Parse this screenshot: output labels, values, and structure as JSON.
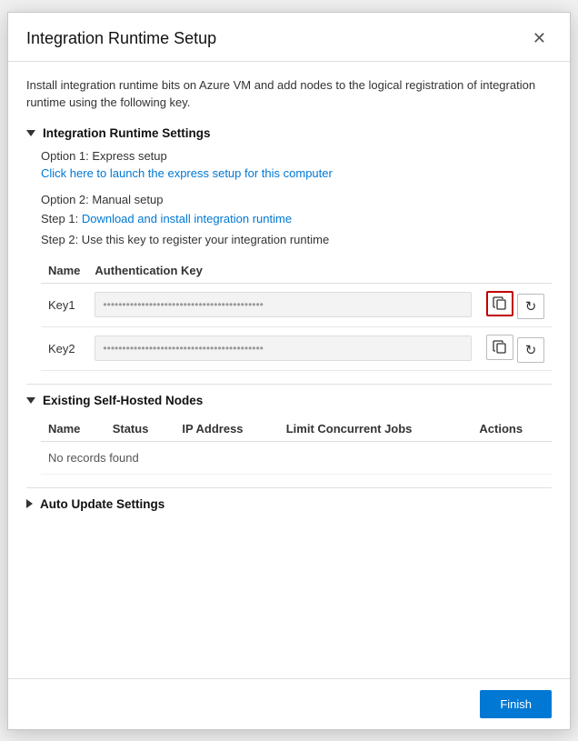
{
  "dialog": {
    "title": "Integration Runtime Setup",
    "close_label": "✕",
    "intro_text": "Install integration runtime bits on Azure VM and add nodes to the logical registration of integration runtime using the following key.",
    "finish_button": "Finish"
  },
  "runtime_settings": {
    "section_label": "Integration Runtime Settings",
    "option1_title": "Option 1: Express setup",
    "option1_link": "Click here to launch the express setup for this computer",
    "option2_title": "Option 2: Manual setup",
    "step1_label": "Step 1:",
    "step1_link": "Download and install integration runtime",
    "step2_text": "Step 2: Use this key to register your integration runtime",
    "table_headers": {
      "name": "Name",
      "auth_key": "Authentication Key"
    },
    "keys": [
      {
        "name": "Key1",
        "value": "••••••••••••••••••••••••••••••••••••••••••••••••••••••"
      },
      {
        "name": "Key2",
        "value": "••••••••••••••••••••••••••••••••••••••••••••••••••••••"
      }
    ]
  },
  "existing_nodes": {
    "section_label": "Existing Self-Hosted Nodes",
    "table_headers": {
      "name": "Name",
      "status": "Status",
      "ip_address": "IP Address",
      "limit_jobs": "Limit Concurrent Jobs",
      "actions": "Actions"
    },
    "no_records_text": "No records found"
  },
  "auto_update": {
    "section_label": "Auto Update Settings"
  }
}
